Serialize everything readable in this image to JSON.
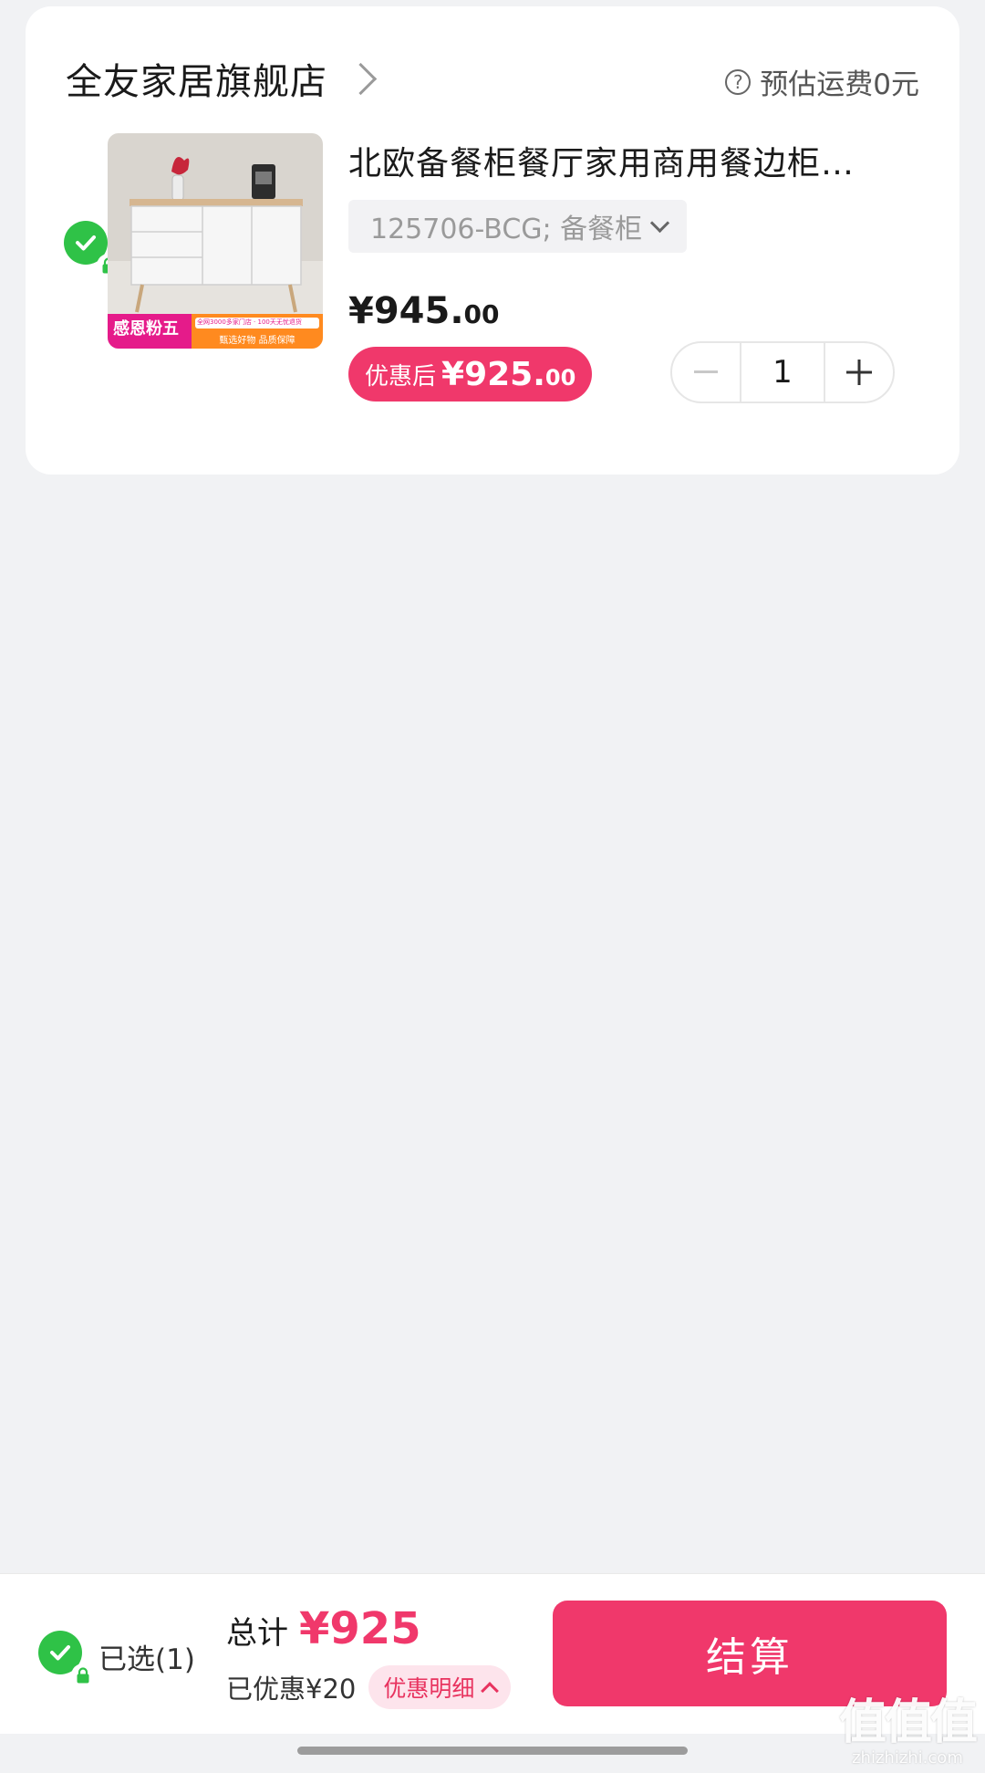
{
  "store": {
    "name": "全友家居旗舰店",
    "shipping_label": "预估运费0元"
  },
  "product": {
    "title": "北欧备餐柜餐厅家用商用餐边柜…",
    "sku": "125706-BCG; 备餐柜",
    "price_main": "¥945.",
    "price_cents": "00",
    "promo_label": "优惠后",
    "promo_price_main": "¥925.",
    "promo_price_cents": "00",
    "quantity": "1",
    "image": {
      "banner_left": "感恩粉五",
      "banner_right_top": "全网3000多家门店 · 100天无忧退货",
      "banner_right_bottom": "甄选好物 品质保障"
    }
  },
  "bottom_bar": {
    "selected_label": "已选(1)",
    "total_label": "总计",
    "total_value": "¥925",
    "saved_label": "已优惠¥20",
    "detail_label": "优惠明细",
    "checkout_label": "结算"
  },
  "watermark": {
    "logo": "值值值",
    "site": "zhizhizhi.com"
  },
  "colors": {
    "accent": "#f0386b",
    "check_green": "#2fc247",
    "background": "#f1f2f4"
  }
}
